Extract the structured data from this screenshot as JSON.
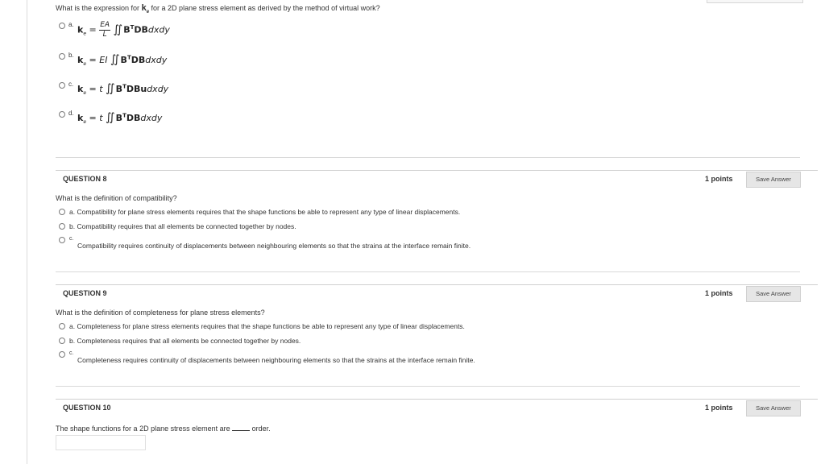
{
  "q7": {
    "prompt_a": "What is the expression for",
    "prompt_k": "k",
    "prompt_sub": "e",
    "prompt_b": "for a 2D plane stress element as derived by the method of virtual work?",
    "options": [
      {
        "letter": "a.",
        "coef_num": "EA",
        "coef_den": "L",
        "pre": "",
        "integrand": "B",
        "sup": "T",
        "rest": "DB",
        "tail": "dxdy"
      },
      {
        "letter": "b.",
        "pre": "EI",
        "integrand": "B",
        "sup": "T",
        "rest": "DB",
        "tail": "dxdy"
      },
      {
        "letter": "c.",
        "pre": "t",
        "integrand": "B",
        "sup": "T",
        "rest": "DBu",
        "tail": "dxdy"
      },
      {
        "letter": "d.",
        "pre": "t",
        "integrand": "B",
        "sup": "T",
        "rest": "DB",
        "tail": "dxdy"
      }
    ],
    "k_symbol": "k",
    "k_sub": "e",
    "equals": "="
  },
  "q8": {
    "title": "QUESTION 8",
    "points": "1 points",
    "save": "Save Answer",
    "prompt": "What is the definition of compatibility?",
    "option_a": "a. Compatibility for plane stress elements requires that the shape functions be able to represent any type of linear displacements.",
    "option_b": "b. Compatibility requires that all elements be connected together by nodes.",
    "option_c_letter": "c.",
    "option_c": "Compatibility requires continuity of displacements between neighbouring elements so that the strains at the interface remain finite."
  },
  "q9": {
    "title": "QUESTION 9",
    "points": "1 points",
    "save": "Save Answer",
    "prompt": "What is the definition of completeness for plane stress elements?",
    "option_a": "a. Completeness for plane stress elements requires that the shape functions be able to represent any type of linear displacements.",
    "option_b": "b. Completeness requires that all elements be connected together by nodes.",
    "option_c_letter": "c.",
    "option_c": "Completeness requires continuity of displacements between neighbouring elements so that the strains at the interface remain finite."
  },
  "q10": {
    "title": "QUESTION 10",
    "points": "1 points",
    "save": "Save Answer",
    "prompt_a": "The shape functions for a 2D plane stress element are",
    "prompt_b": "order."
  }
}
